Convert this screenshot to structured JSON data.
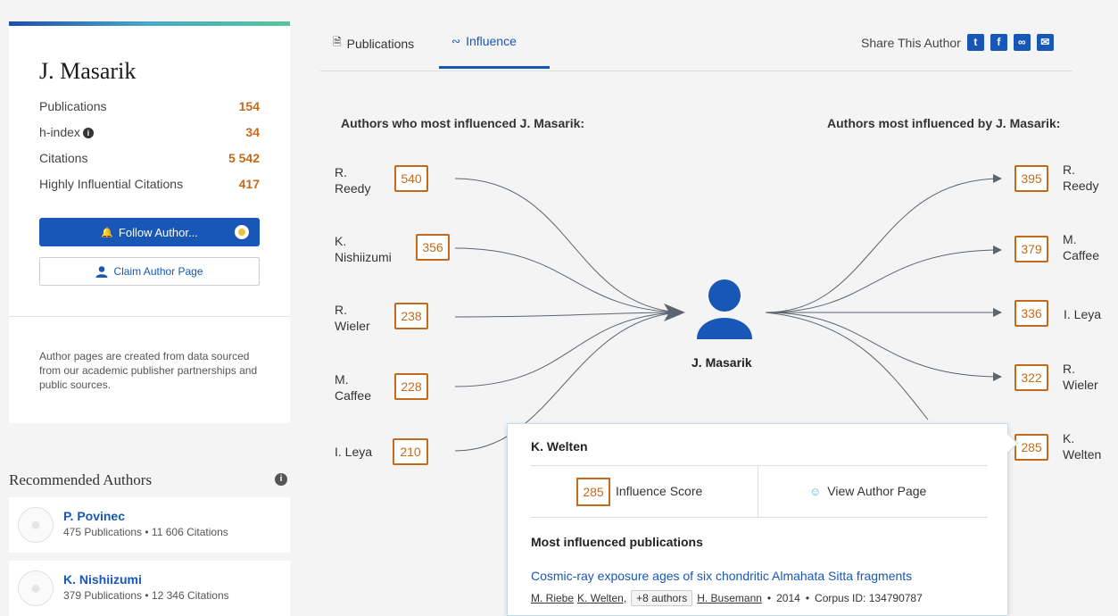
{
  "profile": {
    "name": "J. Masarik",
    "stats": [
      {
        "label": "Publications",
        "value": "154"
      },
      {
        "label": "h-index",
        "value": "34"
      },
      {
        "label": "Citations",
        "value": "5 542"
      },
      {
        "label": "Highly Influential Citations",
        "value": "417"
      }
    ],
    "follow_label": "Follow Author...",
    "claim_label": "Claim Author Page",
    "note": "Author pages are created from data sourced from our academic publisher partnerships and public sources."
  },
  "recommended": {
    "title": "Recommended Authors",
    "items": [
      {
        "name": "P. Povinec",
        "meta": "475 Publications • 11 606 Citations"
      },
      {
        "name": "K. Nishiizumi",
        "meta": "379 Publications • 12 346 Citations"
      }
    ]
  },
  "tabs": {
    "publications": "Publications",
    "influence": "Influence"
  },
  "share": {
    "label": "Share This Author",
    "icons": [
      "twitter-icon",
      "facebook-icon",
      "link-icon",
      "email-icon"
    ]
  },
  "influence": {
    "left_title": "Authors who most influenced J. Masarik:",
    "right_title": "Authors most influenced by J. Masarik:",
    "center_name": "J. Masarik",
    "influencers": [
      {
        "line1": "R.",
        "line2": "Reedy",
        "score": "540"
      },
      {
        "line1": "K.",
        "line2": "Nishiizumi",
        "score": "356"
      },
      {
        "line1": "R.",
        "line2": "Wieler",
        "score": "238"
      },
      {
        "line1": "M.",
        "line2": "Caffee",
        "score": "228"
      },
      {
        "line1": "I. Leya",
        "line2": "",
        "score": "210"
      }
    ],
    "influenced": [
      {
        "line1": "R.",
        "line2": "Reedy",
        "score": "395"
      },
      {
        "line1": "M.",
        "line2": "Caffee",
        "score": "379"
      },
      {
        "line1": "I. Leya",
        "line2": "",
        "score": "336"
      },
      {
        "line1": "R.",
        "line2": "Wieler",
        "score": "322"
      },
      {
        "line1": "K.",
        "line2": "Welten",
        "score": "285"
      }
    ]
  },
  "popup": {
    "name": "K. Welten",
    "score": "285",
    "score_label": "Influence Score",
    "view_label": "View Author Page",
    "sub_title": "Most influenced publications",
    "paper_title": "Cosmic-ray exposure ages of six chondritic Almahata Sitta fragments",
    "authors": [
      "M. Riebe",
      "K. Welten,"
    ],
    "more_authors": "+8 authors",
    "last_author": "H. Busemann",
    "year": "2014",
    "corpus": "Corpus ID: 134790787"
  },
  "colors": {
    "accent": "#1857b6",
    "score": "#c46a1b"
  }
}
